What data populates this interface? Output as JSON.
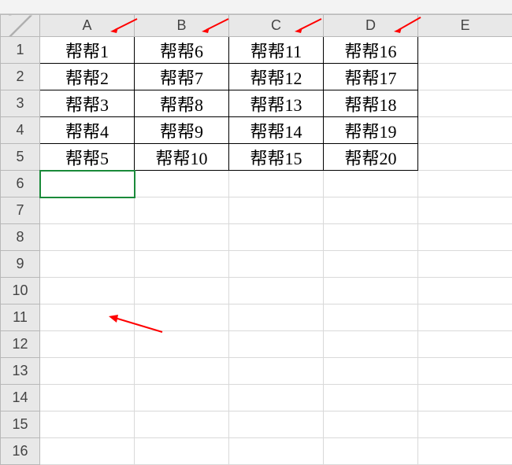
{
  "chart_data": {
    "type": "table",
    "columns": [
      "A",
      "B",
      "C",
      "D",
      "E"
    ],
    "rows": [
      [
        "帮帮1",
        "帮帮6",
        "帮帮11",
        "帮帮16",
        ""
      ],
      [
        "帮帮2",
        "帮帮7",
        "帮帮12",
        "帮帮17",
        ""
      ],
      [
        "帮帮3",
        "帮帮8",
        "帮帮13",
        "帮帮18",
        ""
      ],
      [
        "帮帮4",
        "帮帮9",
        "帮帮14",
        "帮帮19",
        ""
      ],
      [
        "帮帮5",
        "帮帮10",
        "帮帮15",
        "帮帮20",
        ""
      ]
    ],
    "active_cell": "A6",
    "annotations": {
      "arrows_on_column_headers": [
        "A",
        "B",
        "C",
        "D"
      ],
      "arrow_in_body_near": "A11"
    }
  },
  "headers": {
    "cols": [
      "A",
      "B",
      "C",
      "D",
      "E"
    ],
    "rows": [
      "1",
      "2",
      "3",
      "4",
      "5",
      "6",
      "7",
      "8",
      "9",
      "10",
      "11",
      "12",
      "13",
      "14",
      "15",
      "16"
    ]
  },
  "cells": {
    "r1c1": "帮帮1",
    "r1c2": "帮帮6",
    "r1c3": "帮帮11",
    "r1c4": "帮帮16",
    "r2c1": "帮帮2",
    "r2c2": "帮帮7",
    "r2c3": "帮帮12",
    "r2c4": "帮帮17",
    "r3c1": "帮帮3",
    "r3c2": "帮帮8",
    "r3c3": "帮帮13",
    "r3c4": "帮帮18",
    "r4c1": "帮帮4",
    "r4c2": "帮帮9",
    "r4c3": "帮帮14",
    "r4c4": "帮帮19",
    "r5c1": "帮帮5",
    "r5c2": "帮帮10",
    "r5c3": "帮帮15",
    "r5c4": "帮帮20"
  },
  "colors": {
    "arrow": "#ff0000",
    "active_border": "#1a8a3a"
  }
}
